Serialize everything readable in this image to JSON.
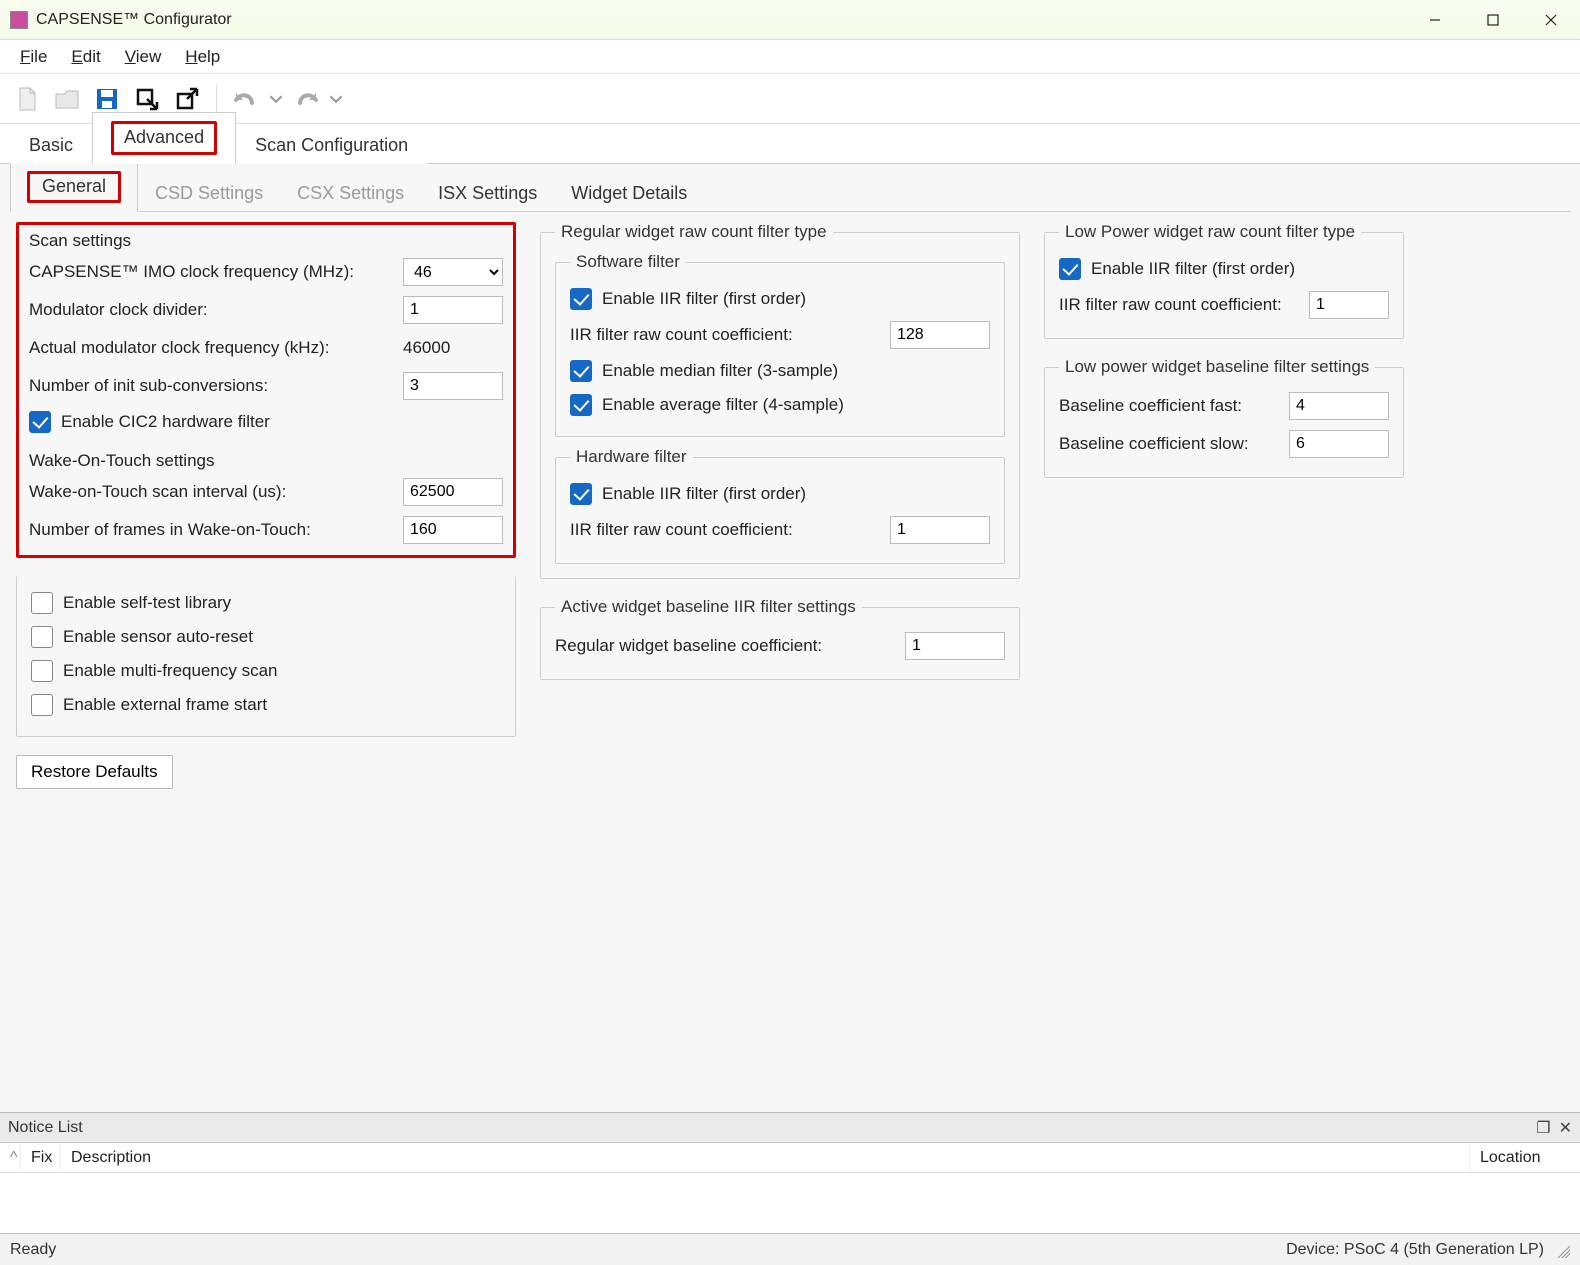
{
  "window": {
    "title": "CAPSENSE™ Configurator"
  },
  "menu": {
    "file": "File",
    "edit": "Edit",
    "view": "View",
    "help": "Help"
  },
  "tabs_main": {
    "basic": "Basic",
    "advanced": "Advanced",
    "scan_config": "Scan Configuration",
    "active": "advanced"
  },
  "tabs_sub": {
    "general": "General",
    "csd": "CSD Settings",
    "csx": "CSX Settings",
    "isx": "ISX Settings",
    "widget": "Widget Details",
    "active": "general"
  },
  "scan_settings": {
    "title": "Scan settings",
    "imo_label": "CAPSENSE™ IMO clock frequency (MHz):",
    "imo_value": "46",
    "mod_div_label": "Modulator clock divider:",
    "mod_div_value": "1",
    "actual_mod_label": "Actual modulator clock frequency (kHz):",
    "actual_mod_value": "46000",
    "init_sub_label": "Number of init sub-conversions:",
    "init_sub_value": "3",
    "cic2_label": "Enable CIC2 hardware filter",
    "cic2_checked": true
  },
  "wot_settings": {
    "title": "Wake-On-Touch settings",
    "interval_label": "Wake-on-Touch scan interval (us):",
    "interval_value": "62500",
    "frames_label": "Number of frames in Wake-on-Touch:",
    "frames_value": "160"
  },
  "options": {
    "self_test": "Enable self-test library",
    "auto_reset": "Enable sensor auto-reset",
    "multi_freq": "Enable multi-frequency scan",
    "ext_frame": "Enable external frame start"
  },
  "restore_defaults": "Restore Defaults",
  "regular_filter": {
    "title": "Regular widget raw count filter type",
    "software": {
      "title": "Software filter",
      "iir_label": "Enable IIR filter (first order)",
      "iir_checked": true,
      "iir_coef_label": "IIR filter raw count coefficient:",
      "iir_coef_value": "128",
      "median_label": "Enable median filter (3-sample)",
      "median_checked": true,
      "avg_label": "Enable average filter (4-sample)",
      "avg_checked": true
    },
    "hardware": {
      "title": "Hardware filter",
      "iir_label": "Enable IIR filter (first order)",
      "iir_checked": true,
      "iir_coef_label": "IIR filter raw count coefficient:",
      "iir_coef_value": "1"
    }
  },
  "active_baseline": {
    "title": "Active widget baseline IIR filter settings",
    "coef_label": "Regular widget baseline coefficient:",
    "coef_value": "1"
  },
  "lp_filter": {
    "title": "Low Power widget raw count filter type",
    "iir_label": "Enable IIR filter (first order)",
    "iir_checked": true,
    "iir_coef_label": "IIR filter raw count coefficient:",
    "iir_coef_value": "1"
  },
  "lp_baseline": {
    "title": "Low power widget baseline filter settings",
    "fast_label": "Baseline coefficient fast:",
    "fast_value": "4",
    "slow_label": "Baseline coefficient slow:",
    "slow_value": "6"
  },
  "notice": {
    "title": "Notice List",
    "cols": {
      "caret": "^",
      "fix": "Fix",
      "desc": "Description",
      "loc": "Location"
    }
  },
  "status": {
    "ready": "Ready",
    "device": "Device: PSoC 4 (5th Generation LP)"
  }
}
